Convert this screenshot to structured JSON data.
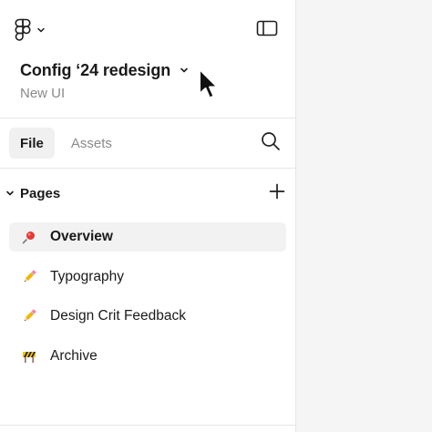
{
  "file": {
    "title": "Config ‘24 redesign",
    "subtitle": "New UI"
  },
  "tabs": [
    {
      "label": "File",
      "active": true
    },
    {
      "label": "Assets",
      "active": false
    }
  ],
  "pages": {
    "title": "Pages",
    "items": [
      {
        "label": "Overview",
        "icon": "pushpin-emoji",
        "selected": true
      },
      {
        "label": "Typography",
        "icon": "pencil-emoji",
        "selected": false
      },
      {
        "label": "Design Crit Feedback",
        "icon": "pencil-emoji",
        "selected": false
      },
      {
        "label": "Archive",
        "icon": "construction-emoji",
        "selected": false
      }
    ]
  },
  "icons": {
    "logo": "figma-logo-icon",
    "sidebar_toggle": "sidebar-panel-icon",
    "search": "search-icon",
    "add": "plus-icon",
    "chevron": "chevron-down-icon"
  },
  "colors": {
    "panel_bg": "#ffffff",
    "canvas_bg": "#f5f5f5",
    "selected_bg": "#f2f2f2",
    "muted_text": "#8a8a8a"
  }
}
